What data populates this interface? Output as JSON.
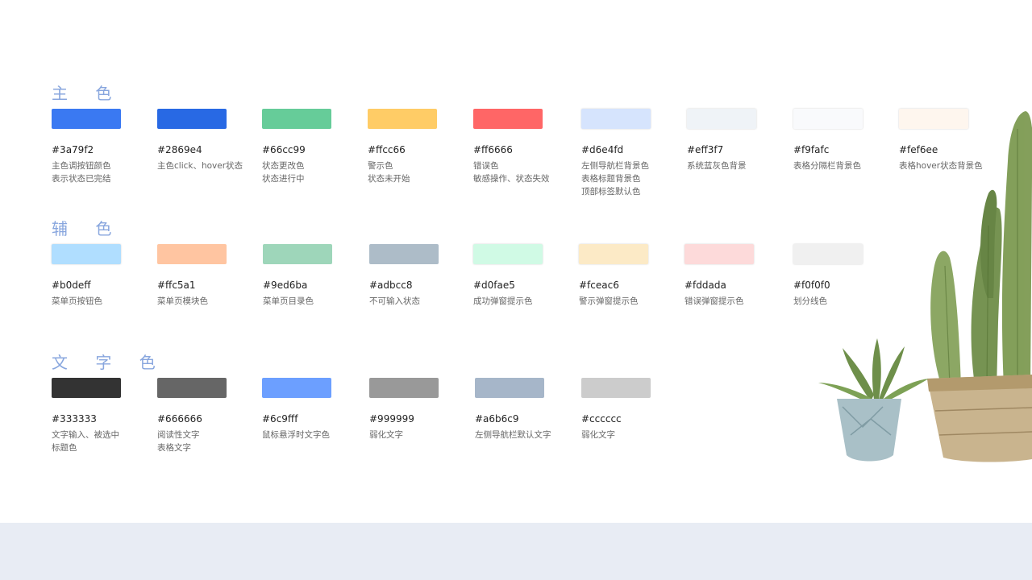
{
  "sections": {
    "primary": {
      "title": "主 色",
      "swatches": [
        {
          "hex": "#3a79f2",
          "code": "#3a79f2",
          "desc": [
            "主色调按钮颜色",
            "表示状态已完结"
          ]
        },
        {
          "hex": "#2869e4",
          "code": "#2869e4",
          "desc": [
            "主色click、hover状态"
          ]
        },
        {
          "hex": "#66cc99",
          "code": "#66cc99",
          "desc": [
            "状态更改色",
            "状态进行中"
          ]
        },
        {
          "hex": "#ffcc66",
          "code": "#ffcc66",
          "desc": [
            "警示色",
            "状态未开始"
          ]
        },
        {
          "hex": "#ff6666",
          "code": "#ff6666",
          "desc": [
            "错误色",
            "敏感操作、状态失效"
          ]
        },
        {
          "hex": "#d6e4fd",
          "code": "#d6e4fd",
          "desc": [
            "左侧导航栏背景色",
            "表格标题背景色",
            "顶部标签默认色"
          ]
        },
        {
          "hex": "#eff3f7",
          "code": "#eff3f7",
          "desc": [
            "系统蓝灰色背景"
          ]
        },
        {
          "hex": "#f9fafc",
          "code": "#f9fafc",
          "desc": [
            "表格分隔栏背景色"
          ]
        },
        {
          "hex": "#fef6ee",
          "code": "#fef6ee",
          "desc": [
            "表格hover状态背景色"
          ]
        }
      ]
    },
    "auxiliary": {
      "title": "辅 色",
      "swatches": [
        {
          "hex": "#b0deff",
          "code": "#b0deff",
          "desc": [
            "菜单页按钮色"
          ]
        },
        {
          "hex": "#ffc5a1",
          "code": "#ffc5a1",
          "desc": [
            "菜单页模块色"
          ]
        },
        {
          "hex": "#9ed6ba",
          "code": "#9ed6ba",
          "desc": [
            "菜单页目录色"
          ]
        },
        {
          "hex": "#adbcc8",
          "code": "#adbcc8",
          "desc": [
            "不可输入状态"
          ]
        },
        {
          "hex": "#d0fae5",
          "code": "#d0fae5",
          "desc": [
            "成功弹窗提示色"
          ]
        },
        {
          "hex": "#fceac6",
          "code": "#fceac6",
          "desc": [
            "警示弹窗提示色"
          ]
        },
        {
          "hex": "#fddada",
          "code": "#fddada",
          "desc": [
            "错误弹窗提示色"
          ]
        },
        {
          "hex": "#f0f0f0",
          "code": "#f0f0f0",
          "desc": [
            "划分线色"
          ]
        }
      ]
    },
    "text": {
      "title": "文 字 色",
      "swatches": [
        {
          "hex": "#333333",
          "code": "#333333",
          "desc": [
            "文字输入、被选中",
            "标题色"
          ]
        },
        {
          "hex": "#666666",
          "code": "#666666",
          "desc": [
            "阅读性文字",
            "表格文字"
          ]
        },
        {
          "hex": "#6c9fff",
          "code": "#6c9fff",
          "desc": [
            "鼠标悬浮时文字色"
          ]
        },
        {
          "hex": "#999999",
          "code": "#999999",
          "desc": [
            "弱化文字"
          ]
        },
        {
          "hex": "#a6b6c9",
          "code": "#a6b6c9",
          "desc": [
            "左侧导航栏默认文字"
          ]
        },
        {
          "hex": "#cccccc",
          "code": "#cccccc",
          "desc": [
            "弱化文字"
          ]
        }
      ]
    }
  },
  "colors": {
    "title": "#88a6de",
    "footer_band": "#e8ecf4"
  },
  "decoration": {
    "icon": "potted-plants-illustration-icon"
  }
}
